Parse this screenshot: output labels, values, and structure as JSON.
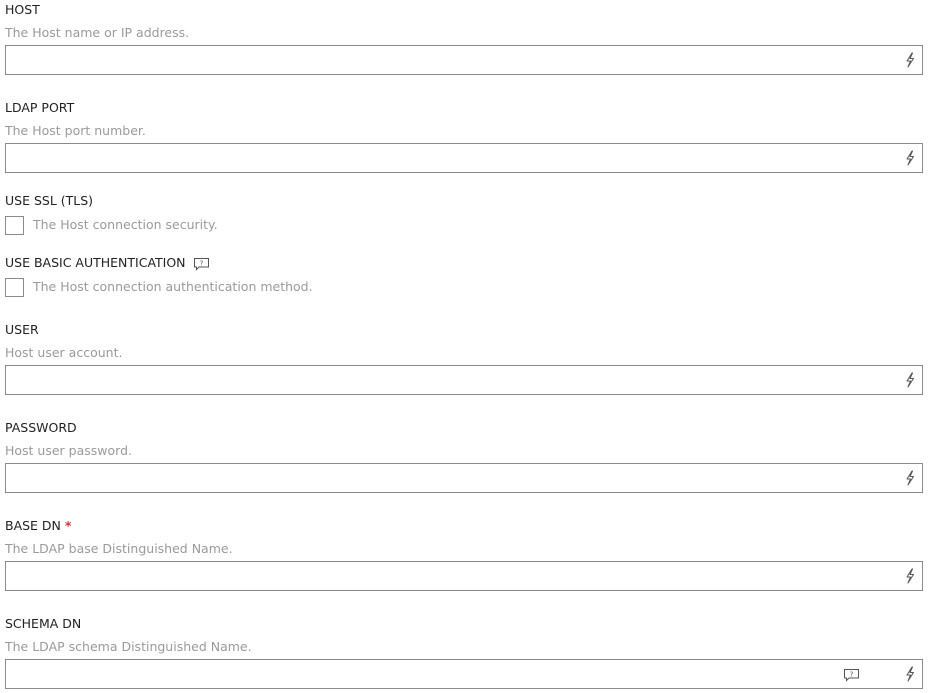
{
  "fields": {
    "host": {
      "label": "HOST",
      "description": "The Host name or IP address.",
      "value": ""
    },
    "ldap_port": {
      "label": "LDAP PORT",
      "description": "The Host port number.",
      "value": ""
    },
    "use_ssl": {
      "label": "USE SSL (TLS)",
      "description": "The Host connection security.",
      "checked": false
    },
    "use_basic_auth": {
      "label": "USE BASIC AUTHENTICATION",
      "description": "The Host connection authentication method.",
      "checked": false
    },
    "user": {
      "label": "USER",
      "description": "Host user account.",
      "value": ""
    },
    "password": {
      "label": "PASSWORD",
      "description": "Host user password.",
      "value": ""
    },
    "base_dn": {
      "label": "BASE DN",
      "required_marker": "*",
      "description": "The LDAP base Distinguished Name.",
      "value": ""
    },
    "schema_dn": {
      "label": "SCHEMA DN",
      "description": "The LDAP schema Distinguished Name.",
      "value": ""
    }
  },
  "colors": {
    "label_text": "#222222",
    "description_text": "#9a9a9a",
    "input_border": "#8a8a8a",
    "required_marker": "#d13438",
    "icon_stroke": "#555555"
  },
  "icons": {
    "dynamic_content": "lightning-bolt-icon",
    "info": "speech-bubble-question-icon"
  }
}
